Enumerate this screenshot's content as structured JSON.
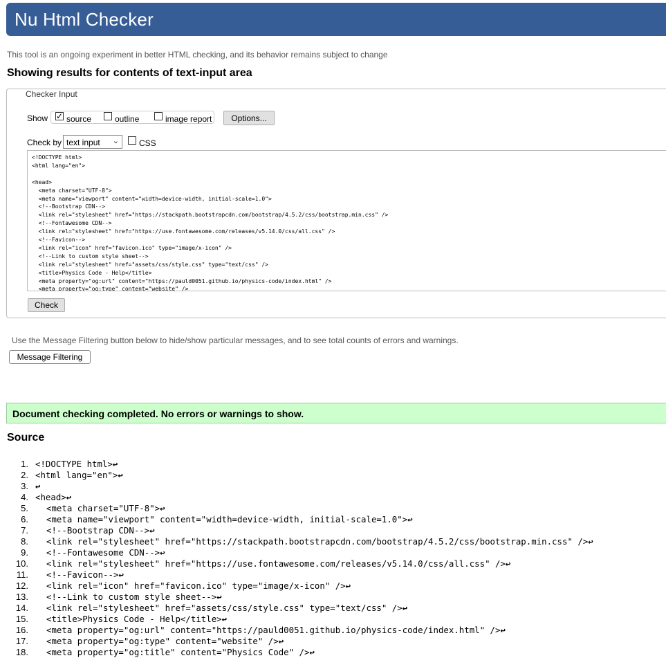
{
  "header": {
    "title": "Nu Html Checker"
  },
  "tagline": "This tool is an ongoing experiment in better HTML checking, and its behavior remains subject to change",
  "results_heading": "Showing results for contents of text-input area",
  "checker": {
    "legend": "Checker Input",
    "show_label": "Show",
    "options": [
      {
        "label": "source",
        "checked": true
      },
      {
        "label": "outline",
        "checked": false
      },
      {
        "label": "image report",
        "checked": false
      }
    ],
    "options_button": "Options...",
    "check_by_label": "Check by",
    "check_by_value": "text input",
    "css_label": "CSS",
    "check_button": "Check",
    "textarea_lines": [
      "<!DOCTYPE html>",
      "<html lang=\"en\">",
      "",
      "<head>",
      "  <meta charset=\"UTF-8\">",
      "  <meta name=\"viewport\" content=\"width=device-width, initial-scale=1.0\">",
      "  <!--Bootstrap CDN-->",
      "  <link rel=\"stylesheet\" href=\"https://stackpath.bootstrapcdn.com/bootstrap/4.5.2/css/bootstrap.min.css\" />",
      "  <!--Fontawesome CDN-->",
      "  <link rel=\"stylesheet\" href=\"https://use.fontawesome.com/releases/v5.14.0/css/all.css\" />",
      "  <!--Favicon-->",
      "  <link rel=\"icon\" href=\"favicon.ico\" type=\"image/x-icon\" />",
      "  <!--Link to custom style sheet-->",
      "  <link rel=\"stylesheet\" href=\"assets/css/style.css\" type=\"text/css\" />",
      "  <title>Physics Code - Help</title>",
      "  <meta property=\"og:url\" content=\"https://pauld0051.github.io/physics-code/index.html\" />",
      "  <meta property=\"og:type\" content=\"website\" />"
    ]
  },
  "filter_note": "Use the Message Filtering button below to hide/show particular messages, and to see total counts of errors and warnings.",
  "filter_button": "Message Filtering",
  "success_message": "Document checking completed. No errors or warnings to show.",
  "source_heading": "Source",
  "return_glyph": "↩",
  "source_lines": [
    {
      "n": "1.",
      "indent": 0,
      "text": "<!DOCTYPE html>"
    },
    {
      "n": "2.",
      "indent": 0,
      "text": "<html lang=\"en\">"
    },
    {
      "n": "3.",
      "indent": 0,
      "text": ""
    },
    {
      "n": "4.",
      "indent": 0,
      "text": "<head>"
    },
    {
      "n": "5.",
      "indent": 1,
      "text": "<meta charset=\"UTF-8\">"
    },
    {
      "n": "6.",
      "indent": 1,
      "text": "<meta name=\"viewport\" content=\"width=device-width, initial-scale=1.0\">"
    },
    {
      "n": "7.",
      "indent": 1,
      "text": "<!--Bootstrap CDN-->"
    },
    {
      "n": "8.",
      "indent": 1,
      "text": "<link rel=\"stylesheet\" href=\"https://stackpath.bootstrapcdn.com/bootstrap/4.5.2/css/bootstrap.min.css\" />"
    },
    {
      "n": "9.",
      "indent": 1,
      "text": "<!--Fontawesome CDN-->"
    },
    {
      "n": "10.",
      "indent": 1,
      "text": "<link rel=\"stylesheet\" href=\"https://use.fontawesome.com/releases/v5.14.0/css/all.css\" />"
    },
    {
      "n": "11.",
      "indent": 1,
      "text": "<!--Favicon-->"
    },
    {
      "n": "12.",
      "indent": 1,
      "text": "<link rel=\"icon\" href=\"favicon.ico\" type=\"image/x-icon\" />"
    },
    {
      "n": "13.",
      "indent": 1,
      "text": "<!--Link to custom style sheet-->"
    },
    {
      "n": "14.",
      "indent": 1,
      "text": "<link rel=\"stylesheet\" href=\"assets/css/style.css\" type=\"text/css\" />"
    },
    {
      "n": "15.",
      "indent": 1,
      "text": "<title>Physics Code - Help</title>"
    },
    {
      "n": "16.",
      "indent": 1,
      "text": "<meta property=\"og:url\" content=\"https://pauld0051.github.io/physics-code/index.html\" />"
    },
    {
      "n": "17.",
      "indent": 1,
      "text": "<meta property=\"og:type\" content=\"website\" />"
    },
    {
      "n": "18.",
      "indent": 1,
      "text": "<meta property=\"og:title\" content=\"Physics Code\" />"
    }
  ]
}
